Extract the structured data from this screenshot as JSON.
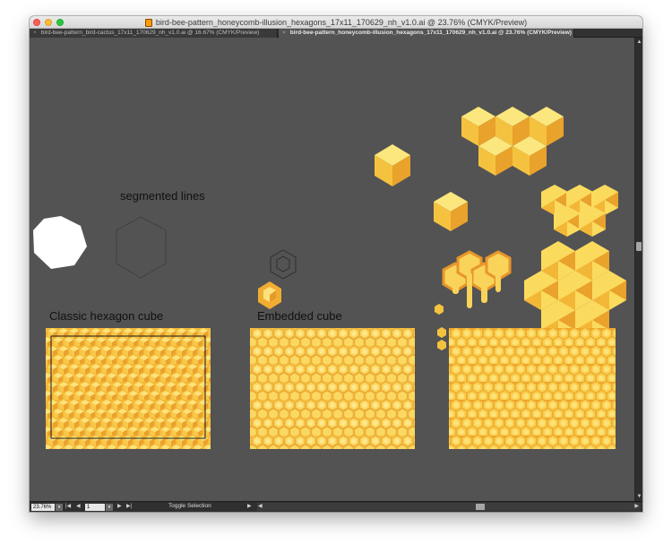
{
  "window": {
    "title": "bird-bee-pattern_honeycomb-illusion_hexagons_17x11_170629_nh_v1.0.ai @ 23.76% (CMYK/Preview)"
  },
  "tabs": [
    {
      "label": "bird-bee-pattern_bird-cactus_17x11_170629_nh_v1.0.ai @ 16.67% (CMYK/Preview)",
      "active": false
    },
    {
      "label": "bird-bee-pattern_honeycomb-illusion_hexagons_17x11_170629_nh_v1.0.ai @ 23.76% (CMYK/Preview)",
      "active": true
    }
  ],
  "artboard": {
    "segmented_label": "segmented lines",
    "panels": [
      {
        "title": "Classic hexagon cube"
      },
      {
        "title": "Embedded cube"
      },
      {
        "title": ""
      }
    ]
  },
  "status": {
    "zoom": "23.76%",
    "page": "1",
    "tool_status": "Toggle Selection"
  },
  "colors": {
    "canvas": "#535353",
    "honey_light": "#fbe46a",
    "honey_mid": "#f6c238",
    "honey_dark": "#e9a22c",
    "honey_outline": "#e7962a"
  }
}
